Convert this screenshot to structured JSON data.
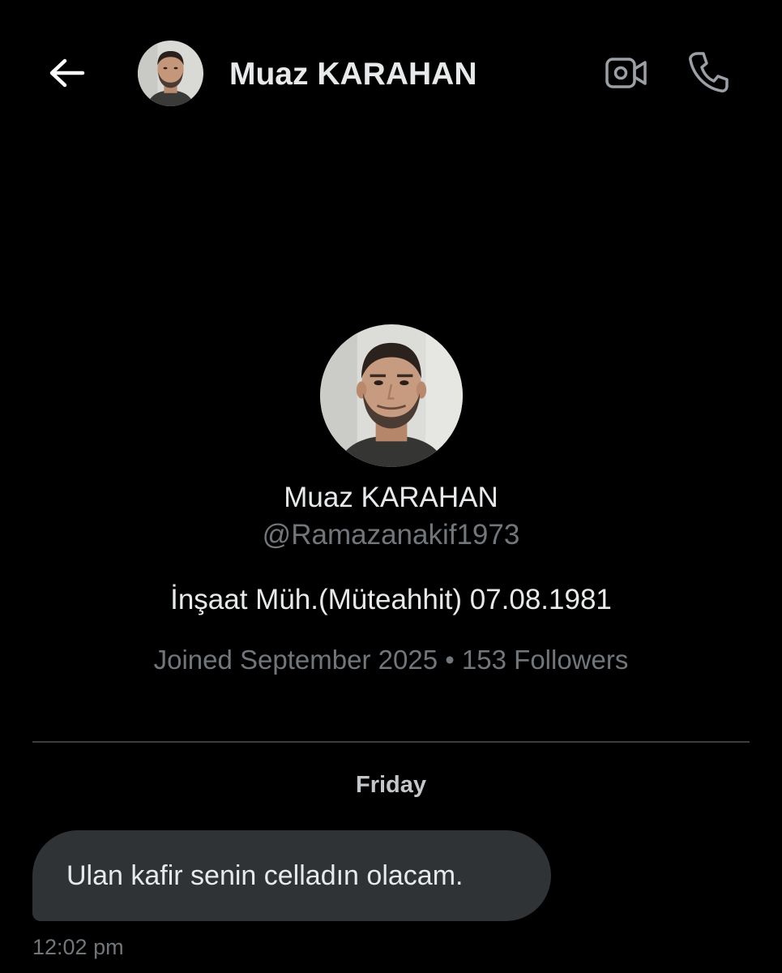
{
  "header": {
    "back_icon": "arrow-left-icon",
    "name": "Muaz KARAHAN",
    "video_call_icon": "video-camera-icon",
    "voice_call_icon": "phone-icon"
  },
  "profile": {
    "name": "Muaz KARAHAN",
    "handle": "@Ramazanakif1973",
    "bio": "İnşaat Müh.(Müteahhit) 07.08.1981",
    "meta": "Joined September 2025 • 153 Followers"
  },
  "conversation": {
    "day_label": "Friday",
    "messages": [
      {
        "text": "Ulan kafir senin celladın olacam.",
        "time": "12:02 pm"
      }
    ]
  },
  "colors": {
    "background": "#000000",
    "primary_text": "#e7e9ea",
    "secondary_text": "#71767b",
    "bubble": "#2f3336",
    "divider": "#3a3d42"
  }
}
